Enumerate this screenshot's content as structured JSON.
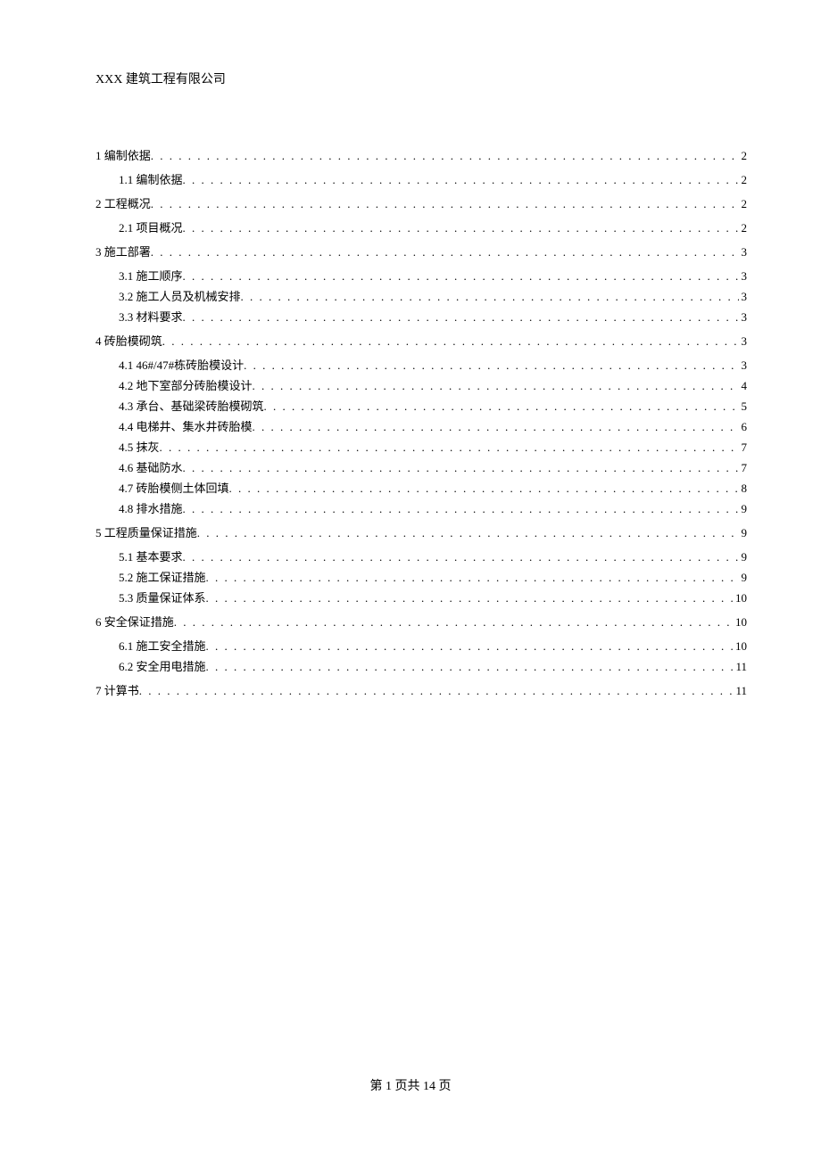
{
  "header": {
    "company": "XXX 建筑工程有限公司"
  },
  "toc": [
    {
      "level": 1,
      "title": "1 编制依据",
      "page": "2"
    },
    {
      "level": 2,
      "title": "1.1 编制依据",
      "page": "2"
    },
    {
      "level": 1,
      "title": "2 工程概况",
      "page": "2"
    },
    {
      "level": 2,
      "title": "2.1 项目概况",
      "page": "2"
    },
    {
      "level": 1,
      "title": "3 施工部署",
      "page": "3"
    },
    {
      "level": 2,
      "title": "3.1 施工顺序",
      "page": "3"
    },
    {
      "level": 2,
      "title": "3.2 施工人员及机械安排",
      "page": "3"
    },
    {
      "level": 2,
      "title": "3.3 材料要求",
      "page": "3"
    },
    {
      "level": 1,
      "title": "4 砖胎模砌筑",
      "page": "3"
    },
    {
      "level": 2,
      "title": "4.1 46#/47#栋砖胎模设计",
      "page": "3"
    },
    {
      "level": 2,
      "title": "4.2 地下室部分砖胎模设计",
      "page": "4"
    },
    {
      "level": 2,
      "title": "4.3 承台、基础梁砖胎模砌筑",
      "page": "5"
    },
    {
      "level": 2,
      "title": "4.4 电梯井、集水井砖胎模",
      "page": "6"
    },
    {
      "level": 2,
      "title": "4.5 抹灰",
      "page": "7"
    },
    {
      "level": 2,
      "title": "4.6 基础防水",
      "page": "7"
    },
    {
      "level": 2,
      "title": "4.7 砖胎模侧土体回填",
      "page": "8"
    },
    {
      "level": 2,
      "title": "4.8 排水措施",
      "page": "9"
    },
    {
      "level": 1,
      "title": "5 工程质量保证措施",
      "page": "9"
    },
    {
      "level": 2,
      "title": "5.1 基本要求",
      "page": "9"
    },
    {
      "level": 2,
      "title": "5.2 施工保证措施",
      "page": "9"
    },
    {
      "level": 2,
      "title": "5.3 质量保证体系",
      "page": "10"
    },
    {
      "level": 1,
      "title": "6 安全保证措施",
      "page": "10"
    },
    {
      "level": 2,
      "title": "6.1 施工安全措施",
      "page": "10"
    },
    {
      "level": 2,
      "title": "6.2 安全用电措施",
      "page": "11"
    },
    {
      "level": 1,
      "title": "7 计算书",
      "page": "11"
    }
  ],
  "footer": {
    "text": "第 1 页共 14 页"
  }
}
